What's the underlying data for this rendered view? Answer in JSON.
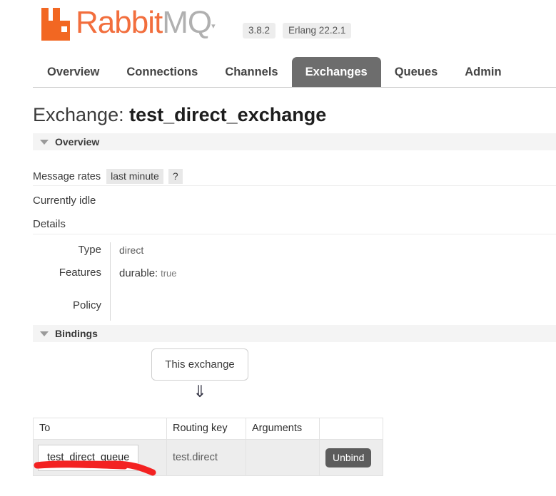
{
  "header": {
    "logo_text_primary": "Rabbit",
    "logo_text_secondary": "MQ",
    "logo_trademark": "▾",
    "version_badge": "3.8.2",
    "erlang_badge": "Erlang 22.2.1",
    "brand_orange": "#f26722",
    "brand_gray": "#b0b0b0"
  },
  "nav": {
    "items": [
      {
        "label": "Overview",
        "active": false
      },
      {
        "label": "Connections",
        "active": false
      },
      {
        "label": "Channels",
        "active": false
      },
      {
        "label": "Exchanges",
        "active": true
      },
      {
        "label": "Queues",
        "active": false
      },
      {
        "label": "Admin",
        "active": false
      }
    ],
    "active_tab_color": "#6d6d6d"
  },
  "page": {
    "title_label": "Exchange:",
    "title_value": "test_direct_exchange"
  },
  "overview": {
    "section_title": "Overview",
    "message_rates_label": "Message rates",
    "message_rates_period": "last minute",
    "help_label": "?",
    "idle_text": "Currently idle",
    "details_label": "Details",
    "details_rows": [
      {
        "key": "Type",
        "value": "direct",
        "feature_key": "",
        "feature_value": ""
      },
      {
        "key": "Features",
        "value": "",
        "feature_key": "durable:",
        "feature_value": "true"
      },
      {
        "key": "Policy",
        "value": "",
        "feature_key": "",
        "feature_value": ""
      }
    ]
  },
  "bindings": {
    "section_title": "Bindings",
    "this_exchange_label": "This exchange",
    "arrow_glyph": "⇓",
    "columns": [
      "To",
      "Routing key",
      "Arguments",
      ""
    ],
    "rows": [
      {
        "to": "test_direct_queue",
        "routing_key": "test.direct",
        "arguments": "",
        "action_label": "Unbind"
      }
    ]
  },
  "annotation": {
    "color": "#f32222",
    "shape": "red-underline-stroke"
  }
}
